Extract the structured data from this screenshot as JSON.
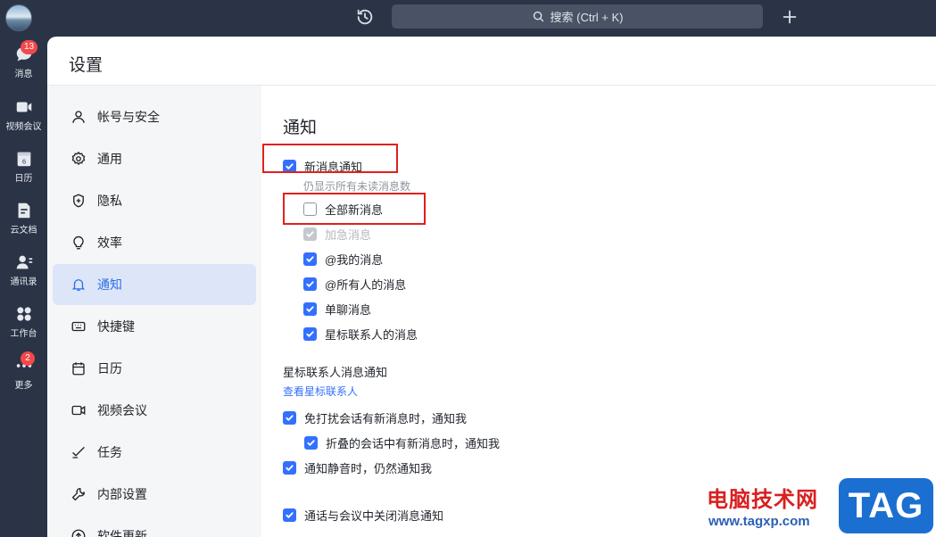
{
  "topbar": {
    "search_placeholder": "搜索 (Ctrl + K)"
  },
  "rail": {
    "items": [
      {
        "label": "消息",
        "icon": "chat-icon",
        "badge": "13"
      },
      {
        "label": "视频会议",
        "icon": "video-icon"
      },
      {
        "label": "日历",
        "icon": "calendar-icon",
        "day": "6"
      },
      {
        "label": "云文档",
        "icon": "cloud-doc-icon"
      },
      {
        "label": "通讯录",
        "icon": "contacts-icon"
      },
      {
        "label": "工作台",
        "icon": "workspace-icon"
      },
      {
        "label": "更多",
        "icon": "more-icon",
        "badge": "2"
      }
    ]
  },
  "settings": {
    "title": "设置",
    "nav": [
      {
        "label": "帐号与安全",
        "icon": "user-icon"
      },
      {
        "label": "通用",
        "icon": "gear-icon"
      },
      {
        "label": "隐私",
        "icon": "shield-icon"
      },
      {
        "label": "效率",
        "icon": "bulb-icon"
      },
      {
        "label": "通知",
        "icon": "bell-icon",
        "active": true
      },
      {
        "label": "快捷键",
        "icon": "keyboard-icon"
      },
      {
        "label": "日历",
        "icon": "calendar-icon"
      },
      {
        "label": "视频会议",
        "icon": "video-icon"
      },
      {
        "label": "任务",
        "icon": "task-icon"
      },
      {
        "label": "内部设置",
        "icon": "wrench-icon"
      },
      {
        "label": "软件更新",
        "icon": "update-icon"
      }
    ]
  },
  "notification": {
    "section_title": "通知",
    "new_message": {
      "label": "新消息通知",
      "checked": true
    },
    "hint": "仍显示所有未读消息数",
    "all_new": {
      "label": "全部新消息",
      "checked": false
    },
    "urgent": {
      "label": "加急消息",
      "checked": true,
      "disabled": true
    },
    "mentions_me": {
      "label": "@我的消息",
      "checked": true
    },
    "mentions_all": {
      "label": "@所有人的消息",
      "checked": true
    },
    "direct": {
      "label": "单聊消息",
      "checked": true
    },
    "starred_contacts": {
      "label": "星标联系人的消息",
      "checked": true
    },
    "starred_section_title": "星标联系人消息通知",
    "view_starred_link": "查看星标联系人",
    "dnd_notify": {
      "label": "免打扰会话有新消息时，通知我",
      "checked": true
    },
    "folded_notify": {
      "label": "折叠的会话中有新消息时，通知我",
      "checked": true
    },
    "muted_notify": {
      "label": "通知静音时，仍然通知我",
      "checked": true
    },
    "call_mute": {
      "label": "通话与会议中关闭消息通知",
      "checked": true
    }
  },
  "watermark": {
    "site_name": "电脑技术网",
    "url": "www.tagxp.com",
    "logo_text": "TAG"
  },
  "colors": {
    "accent": "#3370ff",
    "active_nav_bg": "#dde6f9",
    "rail_bg": "#2b3446",
    "highlight_box": "#e02020"
  }
}
